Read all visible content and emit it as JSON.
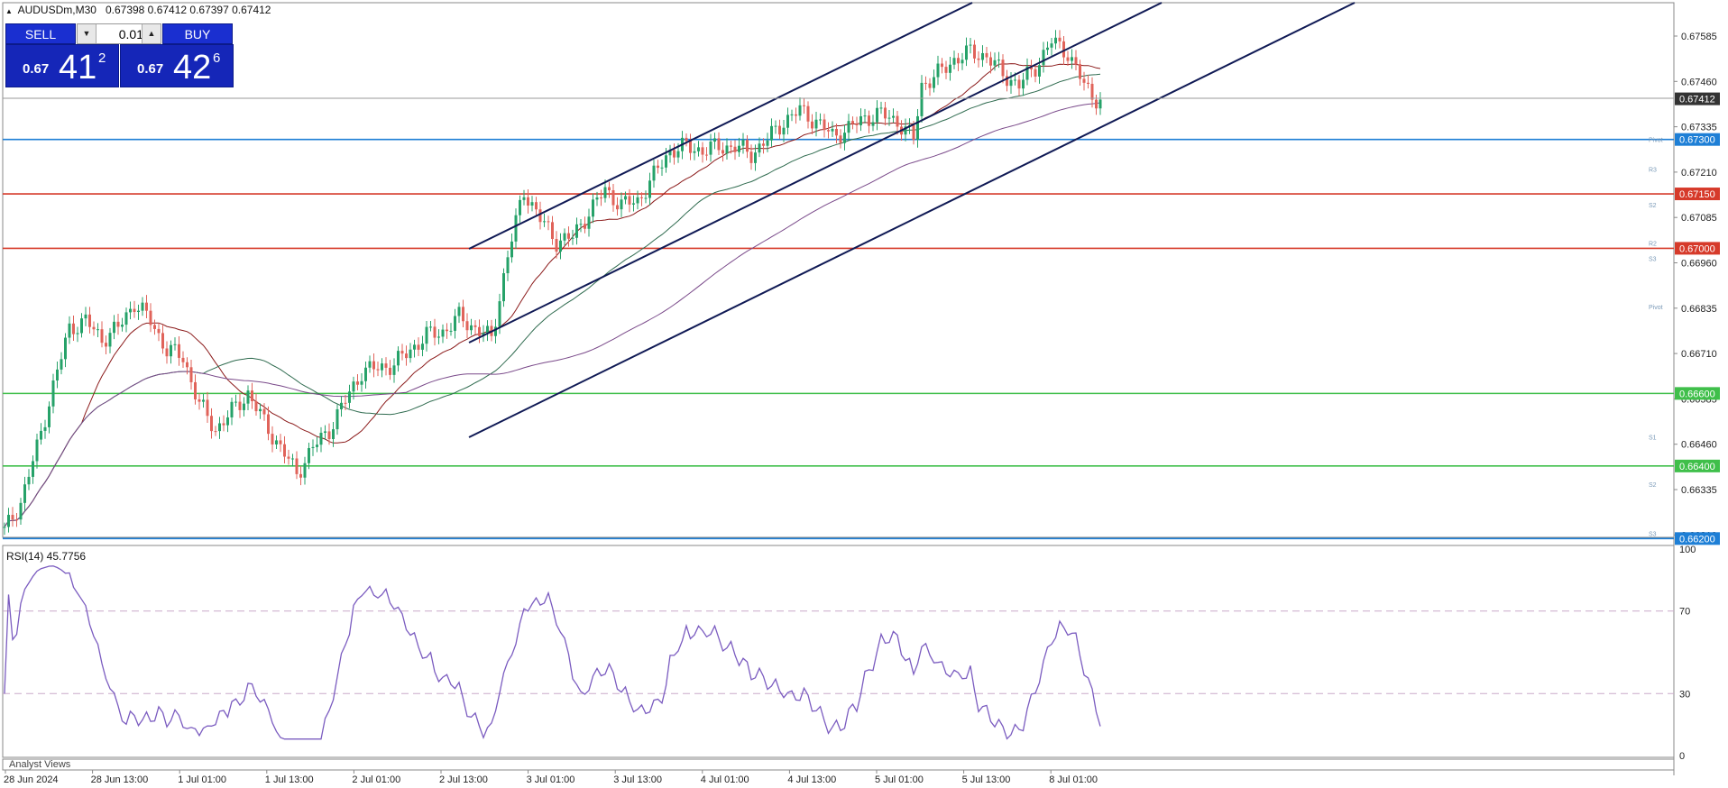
{
  "header": {
    "symbol": "AUDUSDm,M30",
    "ohlc": "0.67398 0.67412 0.67397 0.67412"
  },
  "trade_panel": {
    "sell_label": "SELL",
    "buy_label": "BUY",
    "lot": "0.01",
    "sell_quote": {
      "prefix": "0.67",
      "big": "41",
      "sup": "2"
    },
    "buy_quote": {
      "prefix": "0.67",
      "big": "42",
      "sup": "6"
    }
  },
  "price_axis": {
    "ticks": [
      "0.67585",
      "0.67460",
      "0.67335",
      "0.67210",
      "0.67085",
      "0.66960",
      "0.66835",
      "0.66710",
      "0.66585",
      "0.66460",
      "0.66335",
      "0.66210"
    ],
    "current_price": "0.67412"
  },
  "levels": [
    {
      "price": "0.67300",
      "color": "#1e7fd6",
      "side_label": "Pivot"
    },
    {
      "price": "0.67150",
      "color": "#d63a2a",
      "side_label": "S2"
    },
    {
      "price": "0.67000",
      "color": "#d63a2a",
      "side_label": "S3"
    },
    {
      "price": "0.66600",
      "color": "#3fbf4a",
      "side_label": ""
    },
    {
      "price": "0.66400",
      "color": "#3fbf4a",
      "side_label": "S2"
    },
    {
      "price": "0.66200",
      "color": "#1e7fd6",
      "side_label": "S3"
    }
  ],
  "pivot_markers": [
    {
      "text": "Pivot",
      "price": 0.673
    },
    {
      "text": "R3",
      "price": 0.67218
    },
    {
      "text": "S2",
      "price": 0.6712
    },
    {
      "text": "R2",
      "price": 0.67015
    },
    {
      "text": "S3",
      "price": 0.66972
    },
    {
      "text": "Pivot",
      "price": 0.6684
    },
    {
      "text": "S1",
      "price": 0.6648
    },
    {
      "text": "S2",
      "price": 0.6635
    },
    {
      "text": "S3",
      "price": 0.66215
    }
  ],
  "time_axis": [
    "28 Jun 2024",
    "28 Jun 13:00",
    "1 Jul 01:00",
    "1 Jul 13:00",
    "2 Jul 01:00",
    "2 Jul 13:00",
    "3 Jul 01:00",
    "3 Jul 13:00",
    "4 Jul 01:00",
    "4 Jul 13:00",
    "5 Jul 01:00",
    "5 Jul 13:00",
    "8 Jul 01:00"
  ],
  "rsi": {
    "title": "RSI(14) 45.7756",
    "ticks": [
      "100",
      "70",
      "30",
      "0"
    ],
    "level_high": 70,
    "level_low": 30
  },
  "analyst_label": "Analyst Views",
  "colors": {
    "bull": "#26a269",
    "bear": "#e0635a",
    "rsi_line": "#7b5cc0",
    "channel": "#101a55"
  },
  "chart_data": {
    "type": "candlestick",
    "timeframe": "M30",
    "ylim": [
      0.662,
      0.6765
    ],
    "close_path": [
      [
        0,
        0.6622
      ],
      [
        4,
        0.663
      ],
      [
        8,
        0.6645
      ],
      [
        12,
        0.6662
      ],
      [
        16,
        0.6678
      ],
      [
        20,
        0.668
      ],
      [
        24,
        0.6675
      ],
      [
        28,
        0.6678
      ],
      [
        32,
        0.6685
      ],
      [
        36,
        0.668
      ],
      [
        40,
        0.6672
      ],
      [
        44,
        0.667
      ],
      [
        48,
        0.6657
      ],
      [
        52,
        0.665
      ],
      [
        56,
        0.6655
      ],
      [
        60,
        0.666
      ],
      [
        64,
        0.6652
      ],
      [
        68,
        0.6645
      ],
      [
        72,
        0.6638
      ],
      [
        76,
        0.6645
      ],
      [
        80,
        0.665
      ],
      [
        84,
        0.6658
      ],
      [
        88,
        0.6666
      ],
      [
        92,
        0.6667
      ],
      [
        96,
        0.6668
      ],
      [
        100,
        0.6672
      ],
      [
        104,
        0.6676
      ],
      [
        108,
        0.6677
      ],
      [
        112,
        0.6681
      ],
      [
        116,
        0.6678
      ],
      [
        120,
        0.6675
      ],
      [
        124,
        0.6698
      ],
      [
        128,
        0.6716
      ],
      [
        132,
        0.6708
      ],
      [
        136,
        0.6702
      ],
      [
        140,
        0.6703
      ],
      [
        144,
        0.671
      ],
      [
        148,
        0.6716
      ],
      [
        152,
        0.6712
      ],
      [
        156,
        0.6713
      ],
      [
        160,
        0.672
      ],
      [
        164,
        0.6727
      ],
      [
        168,
        0.6728
      ],
      [
        172,
        0.6727
      ],
      [
        176,
        0.6728
      ],
      [
        180,
        0.6728
      ],
      [
        184,
        0.6726
      ],
      [
        188,
        0.673
      ],
      [
        192,
        0.6735
      ],
      [
        196,
        0.6738
      ],
      [
        200,
        0.6735
      ],
      [
        204,
        0.6731
      ],
      [
        208,
        0.6733
      ],
      [
        212,
        0.6736
      ],
      [
        216,
        0.6737
      ],
      [
        220,
        0.6735
      ],
      [
        224,
        0.673
      ],
      [
        226,
        0.6745
      ],
      [
        230,
        0.6748
      ],
      [
        234,
        0.6752
      ],
      [
        238,
        0.6754
      ],
      [
        242,
        0.6753
      ],
      [
        246,
        0.6748
      ],
      [
        250,
        0.6745
      ],
      [
        254,
        0.675
      ],
      [
        258,
        0.6757
      ],
      [
        262,
        0.6754
      ],
      [
        266,
        0.6745
      ],
      [
        268,
        0.6742
      ],
      [
        270,
        0.6741
      ]
    ],
    "moving_averages": 3,
    "channel_lines": 3,
    "rsi_last": 45.7756
  }
}
